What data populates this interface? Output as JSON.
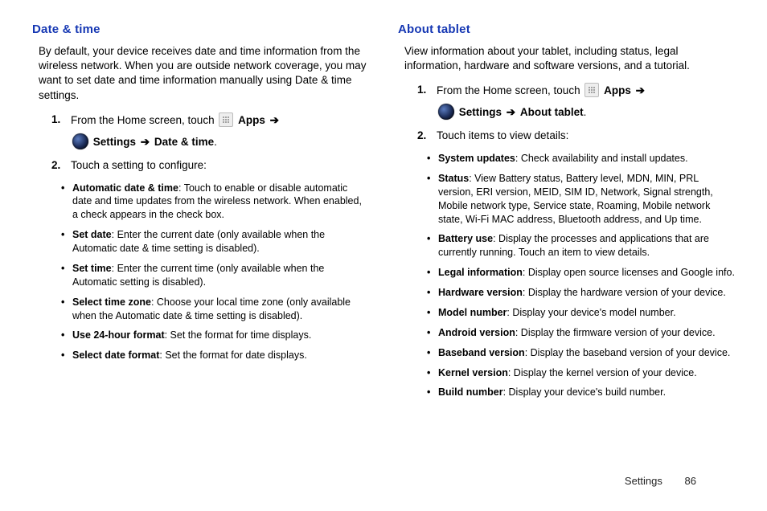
{
  "left": {
    "heading": "Date & time",
    "intro": "By default, your device receives date and time information from the wireless network.  When you are outside network coverage, you may want to set date and time information manually using Date & time settings.",
    "step1_pre": "From the Home screen, touch ",
    "apps_label": "Apps",
    "settings_label": "Settings",
    "step1_end": "Date & time",
    "step2": "Touch a setting to configure:",
    "bullets": [
      {
        "term": "Automatic date & time",
        "desc": ": Touch to enable or disable automatic date and time updates from the wireless network. When enabled, a check appears in the check box."
      },
      {
        "term": "Set date",
        "desc": ": Enter the current date (only available when the Automatic date & time setting is disabled)."
      },
      {
        "term": "Set time",
        "desc": ": Enter the current time (only available when the Automatic setting is disabled)."
      },
      {
        "term": "Select time zone",
        "desc": ": Choose your local time zone (only available when the Automatic date & time setting is disabled)."
      },
      {
        "term": "Use 24-hour format",
        "desc": ": Set the format for time displays."
      },
      {
        "term": "Select date format",
        "desc": ": Set the format for date displays."
      }
    ]
  },
  "right": {
    "heading": "About tablet",
    "intro": "View information about your tablet, including status, legal information, hardware and software versions, and a tutorial.",
    "step1_pre": "From the Home screen, touch ",
    "apps_label": "Apps",
    "settings_label": "Settings",
    "step1_end": "About tablet",
    "step2": "Touch items to view details:",
    "bullets": [
      {
        "term": "System updates",
        "desc": ": Check availability and install updates."
      },
      {
        "term": "Status",
        "desc": ": View Battery status, Battery level, MDN, MIN, PRL version, ERI version, MEID, SIM ID, Network, Signal strength, Mobile network type, Service state, Roaming, Mobile network state, Wi-Fi MAC address, Bluetooth address, and Up time."
      },
      {
        "term": "Battery use",
        "desc": ": Display the processes and applications that are currently running. Touch an item to view details."
      },
      {
        "term": "Legal information",
        "desc": ": Display open source licenses and Google info."
      },
      {
        "term": "Hardware version",
        "desc": ": Display the hardware version of your device."
      },
      {
        "term": "Model number",
        "desc": ": Display your device's model number."
      },
      {
        "term": "Android version",
        "desc": ": Display the firmware version of your device."
      },
      {
        "term": "Baseband version",
        "desc": ": Display the baseband version of your device."
      },
      {
        "term": "Kernel version",
        "desc": ": Display the kernel version of your device."
      },
      {
        "term": "Build number",
        "desc": ": Display your device's build number."
      }
    ]
  },
  "footer": {
    "section": "Settings",
    "page": "86"
  }
}
